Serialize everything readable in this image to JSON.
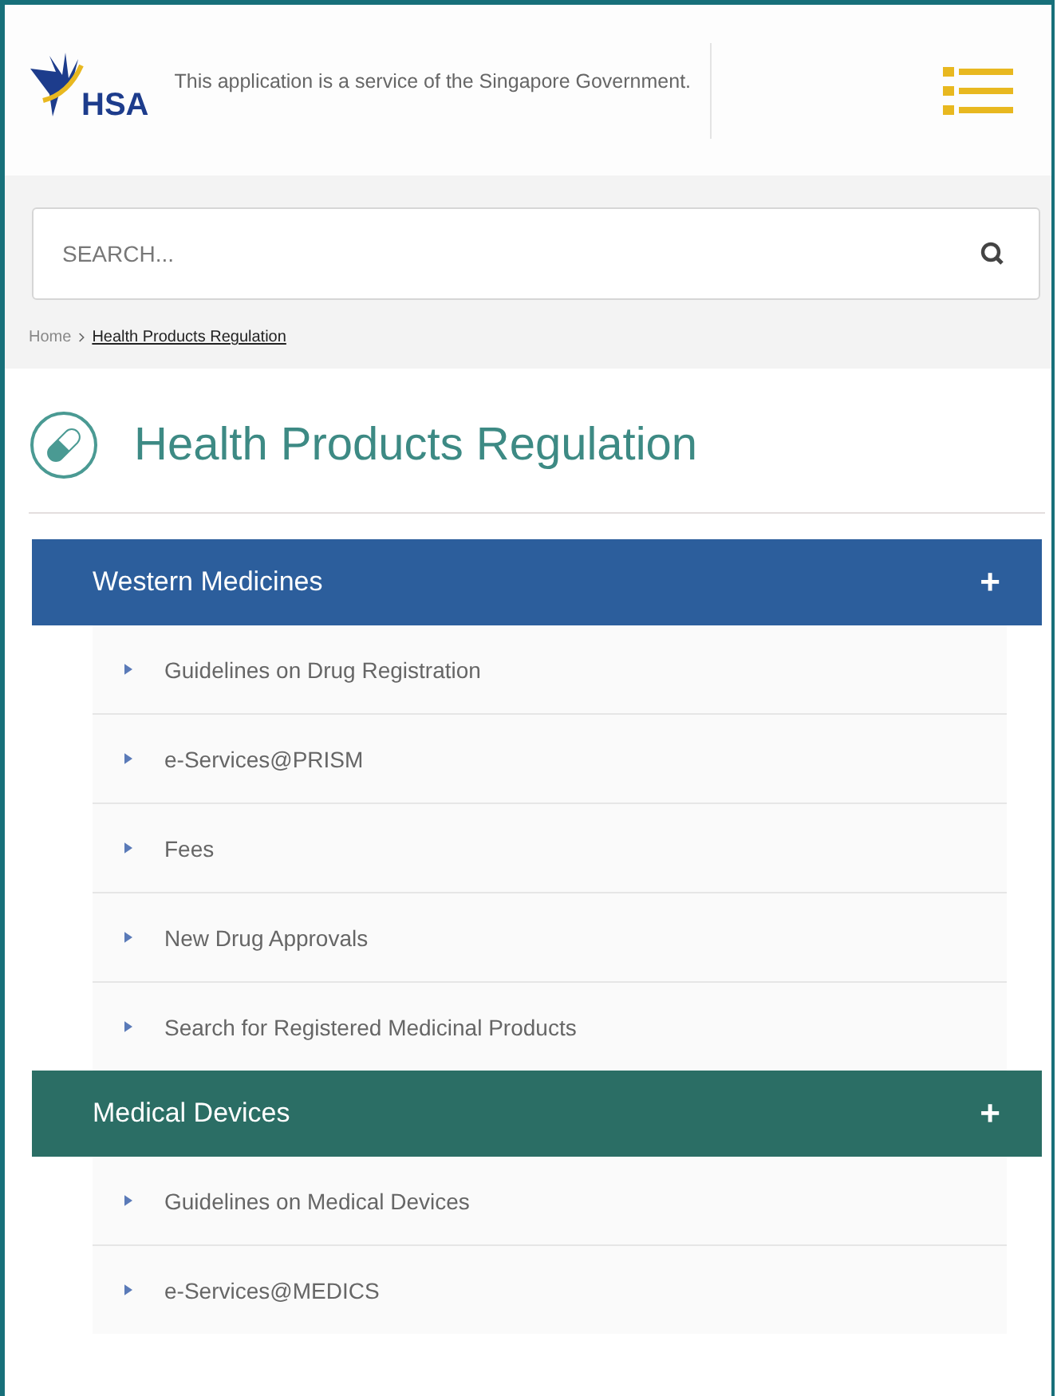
{
  "header": {
    "logo_text": "HSA",
    "tagline": "This application is a service of the Singapore Government."
  },
  "search": {
    "placeholder": "SEARCH..."
  },
  "breadcrumb": [
    {
      "label": "Home",
      "current": false
    },
    {
      "label": "Health Products Regulation",
      "current": true
    }
  ],
  "page_title": "Health Products Regulation",
  "sections": [
    {
      "title": "Western Medicines",
      "color": "#2c5e9c",
      "toggle": "+",
      "items": [
        "Guidelines on Drug Registration",
        "e-Services@PRISM",
        "Fees",
        "New Drug Approvals",
        "Search for Registered Medicinal Products"
      ]
    },
    {
      "title": "Medical Devices",
      "color": "#2b6e65",
      "toggle": "+",
      "items": [
        "Guidelines on Medical Devices",
        "e-Services@MEDICS"
      ]
    }
  ]
}
